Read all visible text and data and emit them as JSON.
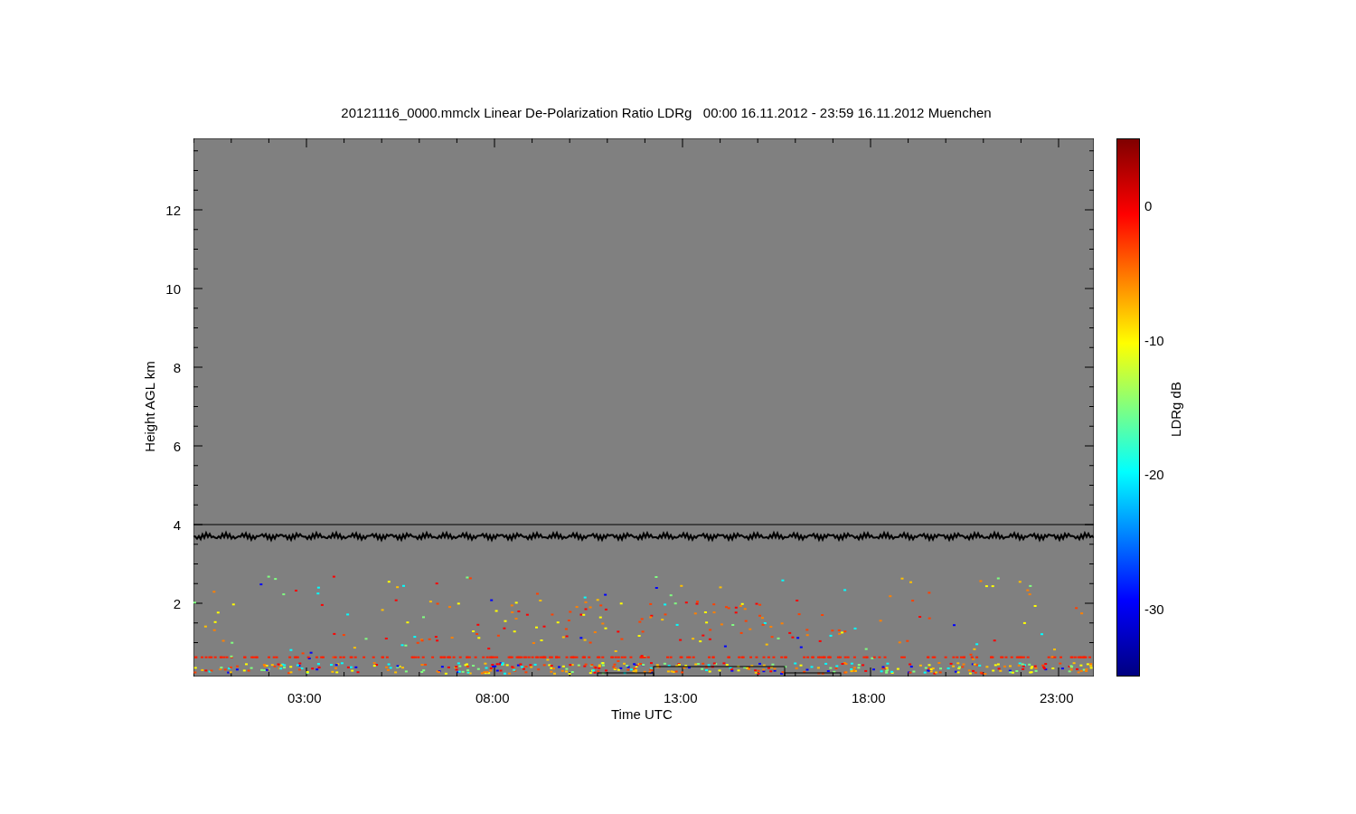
{
  "title": "20121116_0000.mmclx Linear De-Polarization Ratio LDRg   00:00 16.11.2012 - 23:59 16.11.2012 Muenchen",
  "plot": {
    "ylabel": "Height AGL km",
    "yticks": [
      "12",
      "10",
      "8",
      "6",
      "4",
      "2"
    ],
    "xlabel": "Time UTC",
    "xticks": [
      "03:00",
      "08:00",
      "13:00",
      "18:00",
      "23:00"
    ]
  },
  "colorbar": {
    "label": "LDRg dB",
    "ticks": [
      "0",
      "-10",
      "-20",
      "-30"
    ]
  }
}
